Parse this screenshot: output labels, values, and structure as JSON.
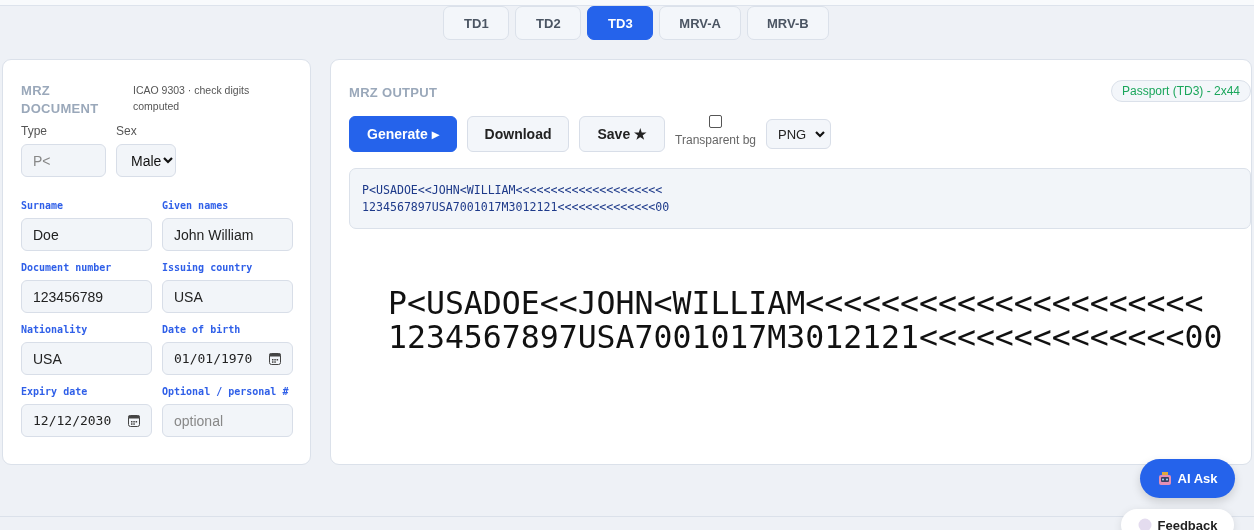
{
  "tabs": [
    {
      "label": "TD1",
      "selected": false
    },
    {
      "label": "TD2",
      "selected": false
    },
    {
      "label": "TD3",
      "selected": true
    },
    {
      "label": "MRV-A",
      "selected": false
    },
    {
      "label": "MRV-B",
      "selected": false
    }
  ],
  "document_panel": {
    "title": "MRZ DOCUMENT",
    "note": "ICAO 9303 · check digits computed",
    "top_fields": [
      {
        "label": "Type",
        "kind": "text",
        "placeholder": "P<"
      },
      {
        "label": "Sex",
        "kind": "select",
        "value": "Male"
      }
    ],
    "fields": [
      {
        "label": "Surname",
        "kind": "text",
        "value": "Doe"
      },
      {
        "label": "Given names",
        "kind": "text",
        "value": "John William"
      },
      {
        "label": "Document number",
        "kind": "text",
        "value": "123456789"
      },
      {
        "label": "Issuing country",
        "kind": "text",
        "value": "USA"
      },
      {
        "label": "Nationality",
        "kind": "text",
        "value": "USA"
      },
      {
        "label": "Date of birth",
        "kind": "date",
        "value": "01/01/1970"
      },
      {
        "label": "Expiry date",
        "kind": "date",
        "value": "12/12/2030"
      },
      {
        "label": "Optional / personal #",
        "kind": "text",
        "placeholder": "optional"
      }
    ]
  },
  "output_panel": {
    "title": "MRZ OUTPUT",
    "badge": "Passport (TD3) - 2x44",
    "buttons": [
      {
        "label": "Generate ▸",
        "primary": true
      },
      {
        "label": "Download",
        "primary": false
      },
      {
        "label": "Save ★",
        "primary": false
      }
    ],
    "transparent_bg": {
      "label": "Transparent bg",
      "checked": false
    },
    "format": "PNG",
    "mrz_text": [
      "P<USADOE<<JOHN<WILLIAM<<<<<<<<<<<<<<<<<<<<<",
      "1234567897USA7001017M3012121<<<<<<<<<<<<<<00"
    ],
    "mrz_preview": [
      "P<USADOE<<JOHN<WILLIAM<<<<<<<<<<<<<<<<<<<<<",
      "1234567897USA7001017M3012121<<<<<<<<<<<<<<00"
    ]
  },
  "ai_ask": "AI Ask",
  "feedback": "Feedback"
}
